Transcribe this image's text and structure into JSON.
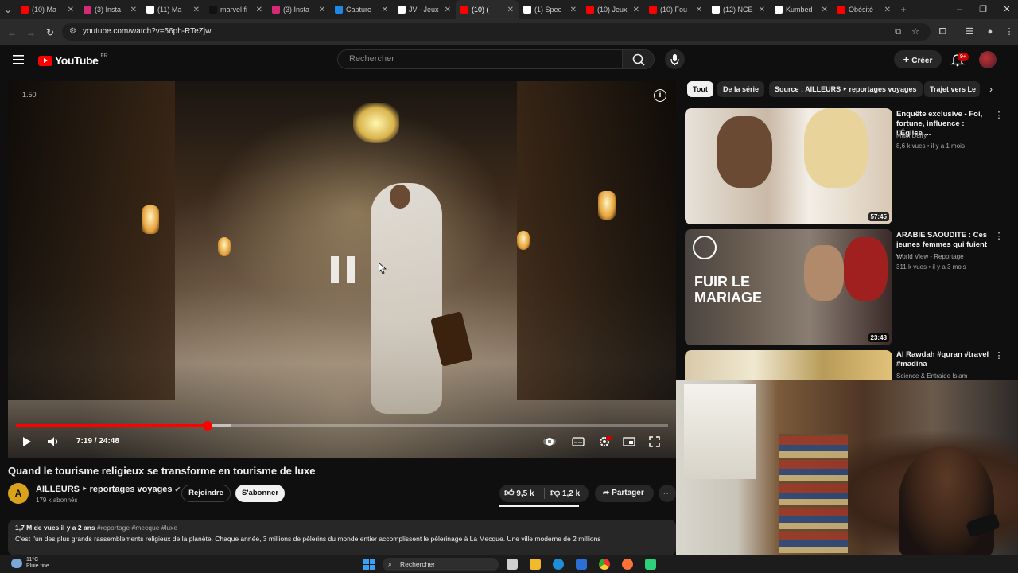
{
  "browser": {
    "tabs": [
      {
        "label": "(10) Ma",
        "color": "#ff0000"
      },
      {
        "label": "(3) Insta",
        "color": "#d62976"
      },
      {
        "label": "(11) Ma",
        "color": "#ffffff"
      },
      {
        "label": "marvel fi",
        "color": "#111111"
      },
      {
        "label": "(3) Insta",
        "color": "#d62976"
      },
      {
        "label": "Capture",
        "color": "#1e88e5"
      },
      {
        "label": "JV - Jeux",
        "color": "#ffffff"
      },
      {
        "label": "(10) (",
        "color": "#ff0000",
        "active": true
      },
      {
        "label": "(1) Spee",
        "color": "#ffffff"
      },
      {
        "label": "(10) Jeux",
        "color": "#ff0000"
      },
      {
        "label": "(10) Fou",
        "color": "#ff0000"
      },
      {
        "label": "(12) NCE",
        "color": "#ffffff"
      },
      {
        "label": "Kumbed",
        "color": "#ffffff"
      },
      {
        "label": "Obésité",
        "color": "#ff0000"
      }
    ],
    "new_tab": "+",
    "url": "youtube.com/watch?v=56ph-RTeZjw"
  },
  "youtube": {
    "logo_text": "YouTube",
    "country": "FR",
    "search_placeholder": "Rechercher",
    "create_label": "Créer",
    "notif_count": "9+"
  },
  "player": {
    "speed": "1.50",
    "time": "7:19 / 24:48",
    "progress": 0.294,
    "buffered": 0.33
  },
  "video": {
    "title": "Quand le tourisme religieux se transforme en tourisme de luxe",
    "channel": "AILLEURS ‣ reportages voyages",
    "channel_initial": "A",
    "subscribers": "179 k abonnés",
    "join_label": "Rejoindre",
    "subscribe_label": "S'abonner",
    "likes": "9,5 k",
    "dislikes": "1,2 k",
    "share_label": "Partager",
    "views_date": "1,7 M de vues  il y a 2 ans",
    "tags": "#reportage #mecque #luxe",
    "description": "C'est l'un des plus grands rassemblements religieux de la planète. Chaque année, 3 millions de pèlerins du monde entier accomplissent le pèlerinage à La Mecque. Une ville moderne de 2 millions"
  },
  "chips": [
    "Tout",
    "De la série",
    "Source : AILLEURS ‣ reportages voyages",
    "Trajet vers Le"
  ],
  "recommendations": [
    {
      "title": "Enquête exclusive - Foi, fortune, influence : l'Église ...",
      "channel": "Mahi Dairy",
      "meta": "8,6 k vues • il y a 1 mois",
      "duration": "57:45"
    },
    {
      "title": "ARABIE SAOUDITE : Ces jeunes femmes qui fuient ...",
      "channel": "World View - Reportage",
      "meta": "311 k vues • il y a 3 mois",
      "duration": "23:48",
      "thumb_text": "FUIR LE MARIAGE"
    },
    {
      "title": "Al Rawdah #quran #travel #madina",
      "channel": "Science & Entraide Islam",
      "meta": "",
      "duration": ""
    }
  ],
  "taskbar": {
    "temp": "11°C",
    "weather": "Pluie fine",
    "search_label": "Rechercher"
  }
}
